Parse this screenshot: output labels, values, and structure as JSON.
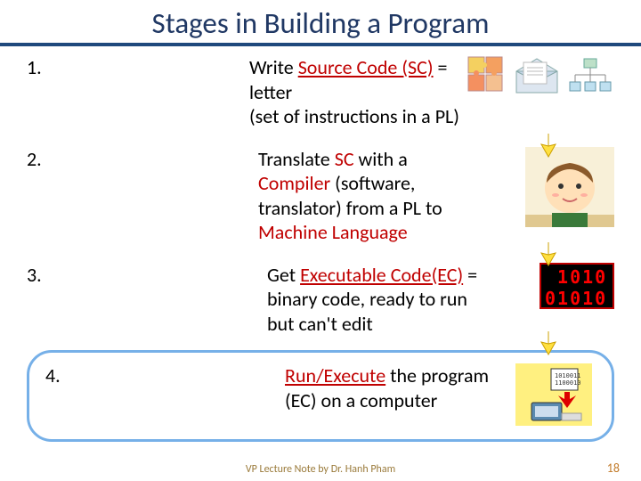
{
  "title": "Stages in Building a Program",
  "item1": {
    "num": "1.",
    "t1": "Write ",
    "kw": "Source Code (SC)",
    "t2": " = letter",
    "t3": "(set of instructions in a PL)"
  },
  "item2": {
    "num": "2.",
    "t1": "Translate ",
    "kw1": "SC",
    "t2": " with a ",
    "kw2": "Compiler",
    "t3": " (software, translator) from a PL to ",
    "kw3": "Machine Language"
  },
  "item3": {
    "num": "3.",
    "t1": "Get ",
    "kw": "Executable Code(EC)",
    "t2": " = binary code, ready to run but can't edit",
    "bin1": " 1010",
    "bin2": "01010"
  },
  "item4": {
    "num": "4.",
    "kw": "Run/Execute",
    "t1": " the program (EC) on a computer"
  },
  "footer": "VP Lecture Note by Dr. Hanh Pham",
  "pagenum": "18"
}
